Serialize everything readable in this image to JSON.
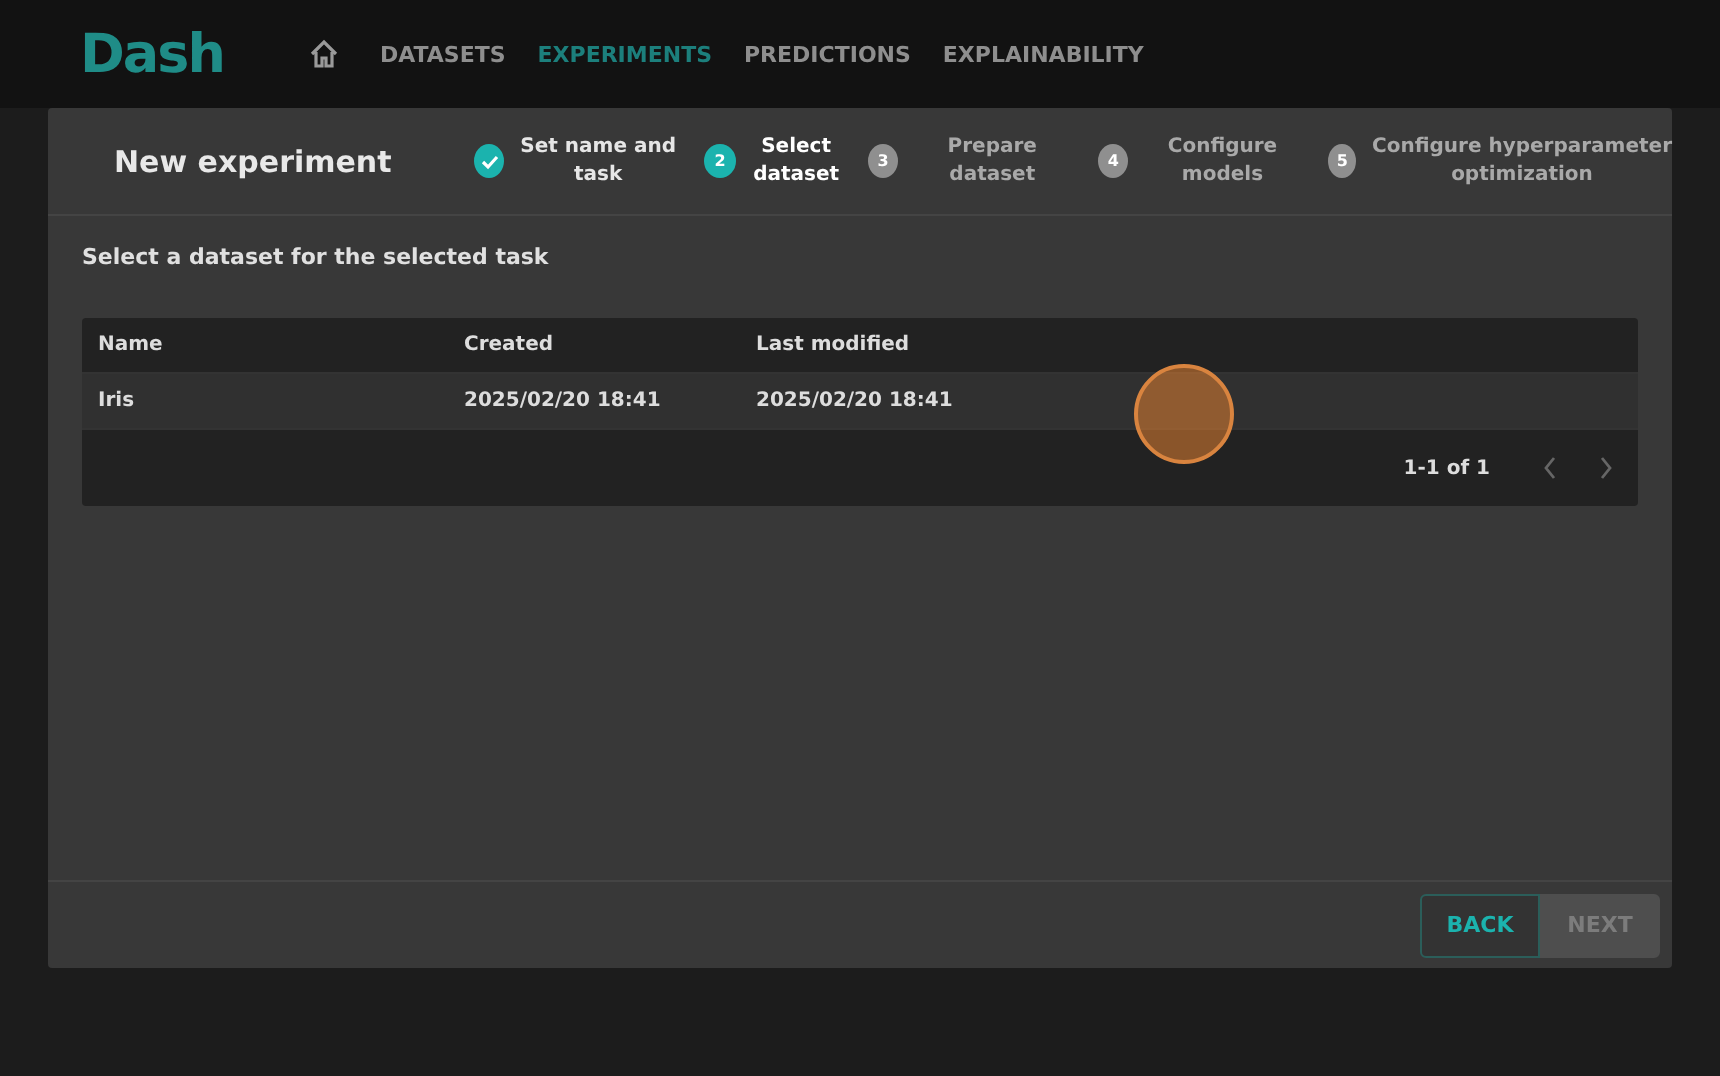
{
  "nav": {
    "logo": "Dash",
    "items": [
      {
        "label": "DATASETS",
        "selected": false
      },
      {
        "label": "EXPERIMENTS",
        "selected": true
      },
      {
        "label": "PREDICTIONS",
        "selected": false
      },
      {
        "label": "EXPLAINABILITY",
        "selected": false
      }
    ]
  },
  "dialog": {
    "title": "New experiment",
    "steps": [
      {
        "label": "Set name and task",
        "completed": true,
        "selected": false
      },
      {
        "number": "2",
        "label": "Select dataset",
        "completed": false,
        "selected": true
      },
      {
        "number": "3",
        "label": "Prepare dataset",
        "completed": false,
        "selected": false
      },
      {
        "number": "4",
        "label": "Configure models",
        "completed": false,
        "selected": false
      },
      {
        "number": "5",
        "label": "Configure hyperparameter optimization",
        "completed": false,
        "selected": false
      }
    ],
    "instruction": "Select a dataset for the selected task",
    "table": {
      "columns": [
        "Name",
        "Created",
        "Last modified"
      ],
      "rows": [
        {
          "cells": [
            "Iris",
            "2025/02/20 18:41",
            "2025/02/20 18:41"
          ],
          "selected": true
        }
      ],
      "pagination": "1-1 of 1"
    },
    "buttons": [
      {
        "label": "BACK",
        "disabled": false
      },
      {
        "label": "NEXT",
        "disabled": true
      }
    ]
  }
}
